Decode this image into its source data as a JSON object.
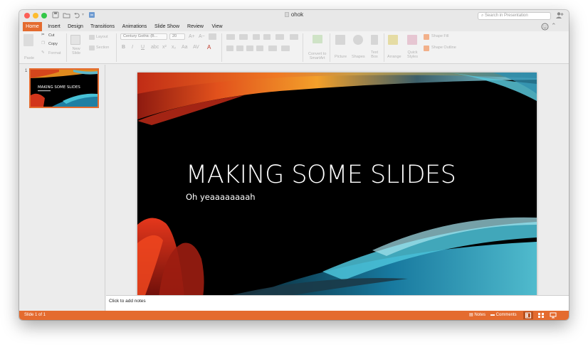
{
  "window": {
    "title": "ohok"
  },
  "titlebar": {
    "search_placeholder": "Search in Presentation"
  },
  "tabs": [
    {
      "label": "Home",
      "active": true
    },
    {
      "label": "Insert"
    },
    {
      "label": "Design"
    },
    {
      "label": "Transitions"
    },
    {
      "label": "Animations"
    },
    {
      "label": "Slide Show"
    },
    {
      "label": "Review"
    },
    {
      "label": "View"
    }
  ],
  "ribbon": {
    "paste": "Paste",
    "cut": "Cut",
    "copy": "Copy",
    "format": "Format",
    "new_slide": "New\nSlide",
    "layout": "Layout",
    "section": "Section",
    "font_name": "Century Gothic (B...",
    "font_size": "20",
    "convert_smartart": "Convert to\nSmartArt",
    "picture": "Picture",
    "shapes": "Shapes",
    "text_box": "Text\nBox",
    "arrange": "Arrange",
    "quick_styles": "Quick\nStyles",
    "shape_fill": "Shape Fill",
    "shape_outline": "Shape Outline"
  },
  "thumbnails": [
    {
      "number": "1",
      "title": "MAKING SOME SLIDES"
    }
  ],
  "slide": {
    "title": "MAKING SOME SLIDES",
    "subtitle": "Oh yeaaaaaaaah"
  },
  "notes": {
    "placeholder": "Click to add notes"
  },
  "status": {
    "slide_counter": "Slide 1 of 1",
    "notes_label": "Notes",
    "comments_label": "Comments"
  },
  "colors": {
    "accent": "#e46b2f",
    "slide_background": "#000000"
  },
  "icons": [
    "close-dot",
    "minimize-dot",
    "zoom-dot",
    "save-icon",
    "open-icon",
    "undo-icon",
    "redo-icon",
    "search-icon",
    "share-icon",
    "smiley-icon",
    "collapse-icon",
    "scissors-icon",
    "copy-icon",
    "format-painter-icon",
    "notes-icon",
    "comments-icon",
    "normal-view-icon",
    "slide-sorter-icon",
    "presenter-view-icon"
  ]
}
